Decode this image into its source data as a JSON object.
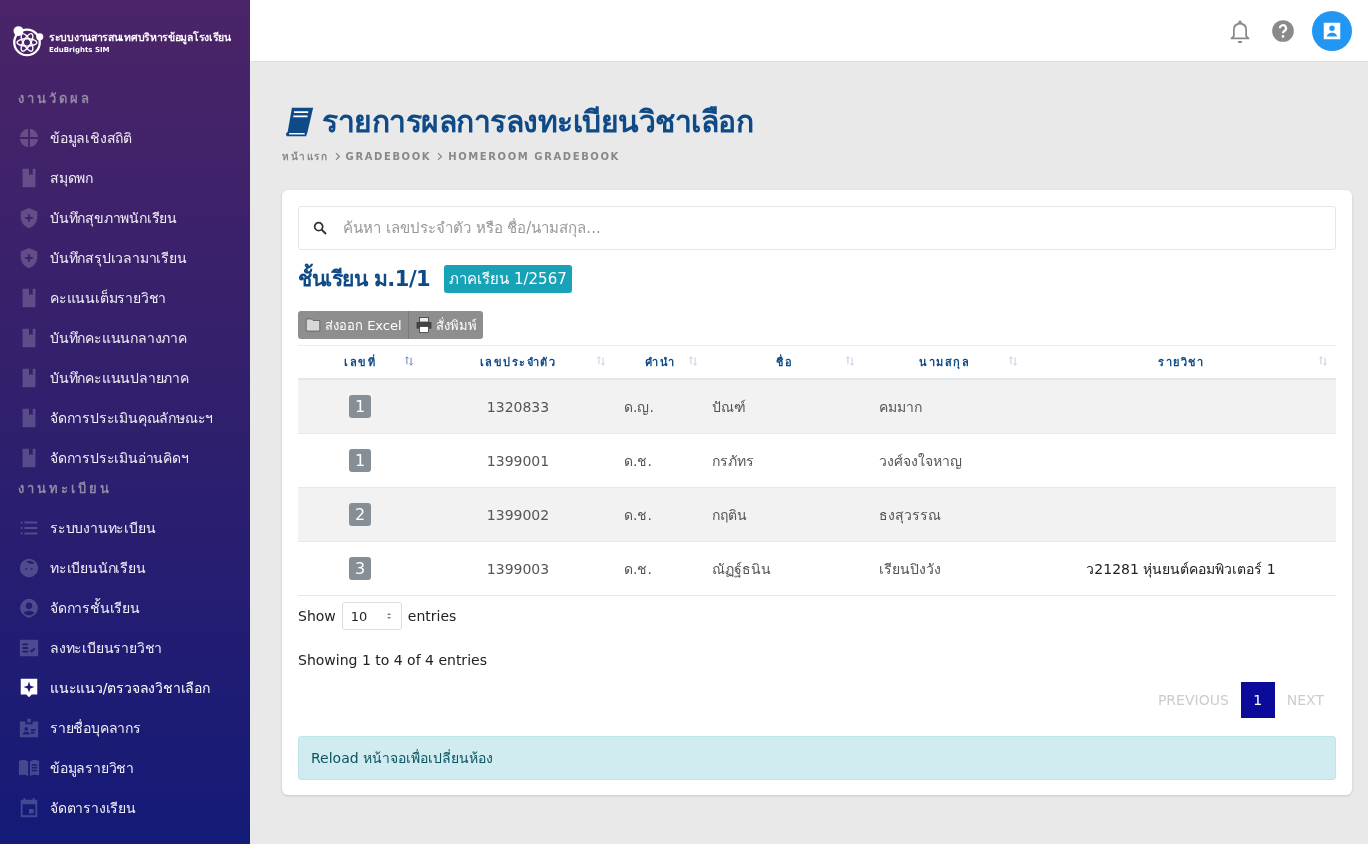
{
  "sidebar": {
    "logo": {
      "title": "ระบบงานสารสนเทศบริหารข้อมูลโรงเรียน",
      "subtitle": "EduBrights SIM"
    },
    "sections": [
      {
        "heading": "งานวัดผล",
        "items": [
          {
            "label": "ข้อมูลเชิงสถิติ",
            "kind": "chart",
            "selected": false
          },
          {
            "label": "สมุดพก",
            "kind": "book",
            "selected": false
          },
          {
            "label": "บันทึกสุขภาพนักเรียน",
            "kind": "shield",
            "selected": false
          },
          {
            "label": "บันทึกสรุปเวลามาเรียน",
            "kind": "shield",
            "selected": false
          },
          {
            "label": "คะแนนเต็มรายวิชา",
            "kind": "book",
            "selected": false
          },
          {
            "label": "บันทึกคะแนนกลางภาค",
            "kind": "book",
            "selected": false
          },
          {
            "label": "บันทึกคะแนนปลายภาค",
            "kind": "book",
            "selected": false
          },
          {
            "label": "จัดการประเมินคุณลักษณะฯ",
            "kind": "book",
            "selected": false
          },
          {
            "label": "จัดการประเมินอ่านคิดฯ",
            "kind": "book",
            "selected": false
          }
        ]
      },
      {
        "heading": "งานทะเบียน",
        "items": [
          {
            "label": "ระบบงานทะเบียน",
            "kind": "list",
            "selected": false
          },
          {
            "label": "ทะเบียนนักเรียน",
            "kind": "face",
            "selected": false
          },
          {
            "label": "จัดการชั้นเรียน",
            "kind": "person",
            "selected": false
          },
          {
            "label": "ลงทะเบียนรายวิชา",
            "kind": "checklist",
            "selected": false
          },
          {
            "label": "แนะแนว/ตรวจลงวิชาเลือก",
            "kind": "sparkle",
            "selected": true
          },
          {
            "label": "รายชื่อบุคลากร",
            "kind": "badge",
            "selected": false
          },
          {
            "label": "ข้อมูลรายวิชา",
            "kind": "openbook",
            "selected": false
          },
          {
            "label": "จัดตารางเรียน",
            "kind": "calendar",
            "selected": false
          }
        ]
      }
    ]
  },
  "page": {
    "title": "รายการผลการลงทะเบียนวิชาเลือก",
    "breadcrumb": [
      "หน้าแรก",
      "GRADEBOOK",
      "HOMEROOM GRADEBOOK"
    ]
  },
  "search": {
    "placeholder": "ค้นหา เลขประจำตัว หรือ ชื่อ/นามสกุล..."
  },
  "class_title": "ชั้นเรียน ม.1/1",
  "term_badge": "ภาคเรียน 1/2567",
  "buttons": [
    {
      "label": "ส่งออก Excel",
      "kind": "excel"
    },
    {
      "label": "สั่งพิมพ์",
      "kind": "print"
    }
  ],
  "table": {
    "columns": [
      {
        "label": "เลขที่",
        "sorted": true
      },
      {
        "label": "เลขประจำตัว",
        "sorted": false
      },
      {
        "label": "คำนำ",
        "sorted": false
      },
      {
        "label": "ชื่อ",
        "sorted": false
      },
      {
        "label": "นามสกุล",
        "sorted": false
      },
      {
        "label": "รายวิชา",
        "sorted": false
      }
    ],
    "rows": [
      {
        "number": "1",
        "id": "1320833",
        "prefix": "ด.ญ.",
        "first_name": "ปัณฑ์",
        "last_name": "คมมาก"
      },
      {
        "number": "1",
        "id": "1399001",
        "prefix": "ด.ช.",
        "first_name": "กรภัทร",
        "last_name": "วงศ์จงใจหาญ"
      },
      {
        "number": "2",
        "id": "1399002",
        "prefix": "ด.ช.",
        "first_name": "กฤติน",
        "last_name": "ธงสุวรรณ"
      },
      {
        "number": "3",
        "id": "1399003",
        "prefix": "ด.ช.",
        "first_name": "ณัฏฐ์ธนิน",
        "last_name": "เรียนปิงวัง",
        "subject": "ว21281 หุ่นยนต์คอมพิวเตอร์ 1"
      }
    ]
  },
  "length": {
    "before": "Show",
    "value": "10",
    "after": "entries"
  },
  "info": "Showing 1 to 4 of 4 entries",
  "pagination": [
    {
      "label": "PREVIOUS",
      "kind": "nav",
      "disabled": true,
      "selected": false
    },
    {
      "label": "1",
      "kind": "page",
      "disabled": false,
      "selected": true
    },
    {
      "label": "NEXT",
      "kind": "nav",
      "disabled": true,
      "selected": false
    }
  ],
  "alert": "Reload หน้าจอเพื่อเปลี่ยนห้อง"
}
